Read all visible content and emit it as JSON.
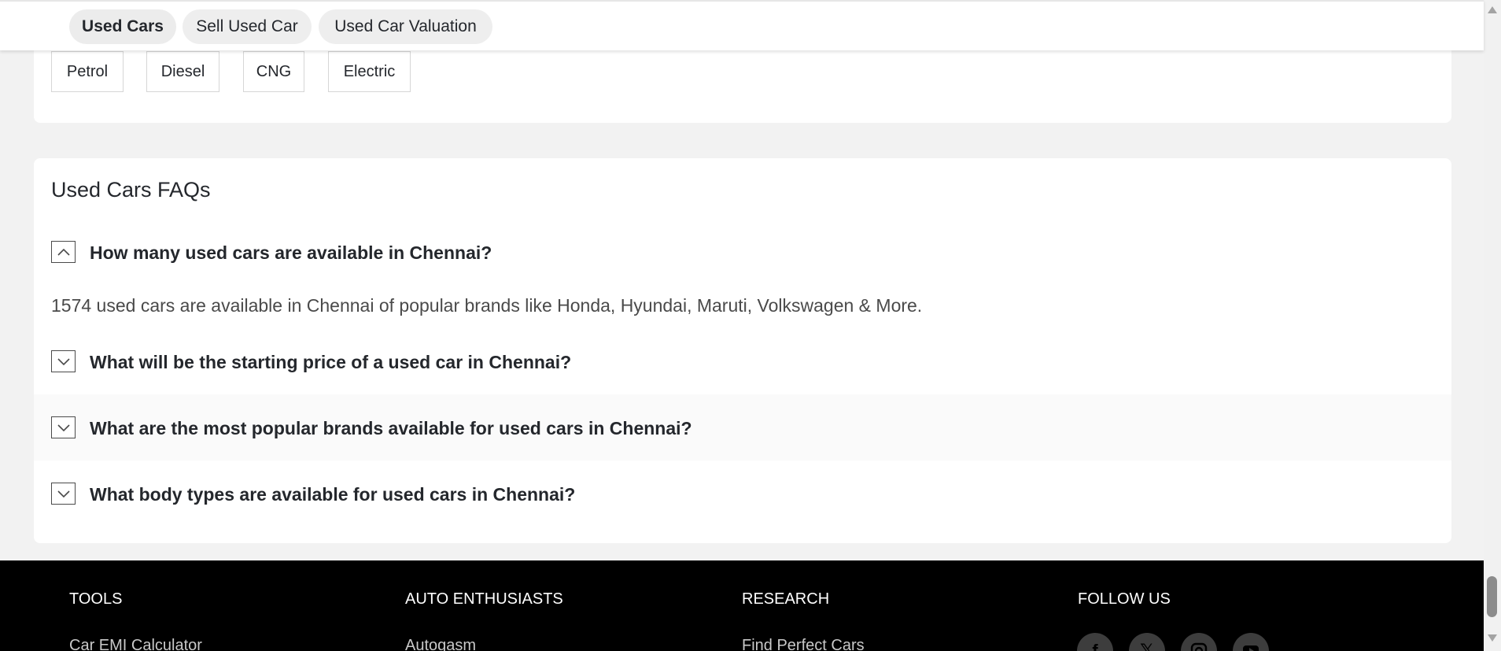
{
  "tabs": [
    {
      "label": "Used Cars",
      "active": true
    },
    {
      "label": "Sell Used Car",
      "active": false
    },
    {
      "label": "Used Car Valuation",
      "active": false
    }
  ],
  "fuel_types": [
    "Petrol",
    "Diesel",
    "CNG",
    "Electric"
  ],
  "faq": {
    "title": "Used Cars FAQs",
    "items": [
      {
        "question": "How many used cars are available in Chennai?",
        "expanded": true,
        "answer": "1574 used cars are available in Chennai of popular brands like Honda, Hyundai, Maruti, Volkswagen & More."
      },
      {
        "question": "What will be the starting price of a used car in Chennai?",
        "expanded": false
      },
      {
        "question": "What are the most popular brands available for used cars in Chennai?",
        "expanded": false
      },
      {
        "question": "What body types are available for used cars in Chennai?",
        "expanded": false
      }
    ]
  },
  "footer": {
    "columns": [
      {
        "heading": "TOOLS",
        "first_link": "Car EMI Calculator"
      },
      {
        "heading": "AUTO ENTHUSIASTS",
        "first_link": "Autogasm"
      },
      {
        "heading": "RESEARCH",
        "first_link": "Find Perfect Cars"
      },
      {
        "heading": "FOLLOW US"
      }
    ],
    "social_icons": [
      "facebook-icon",
      "x-icon",
      "instagram-icon",
      "youtube-icon"
    ]
  },
  "colors": {
    "page_bg": "#f2f2f2",
    "card_bg": "#ffffff",
    "footer_bg": "#000000",
    "text": "#24272c"
  }
}
